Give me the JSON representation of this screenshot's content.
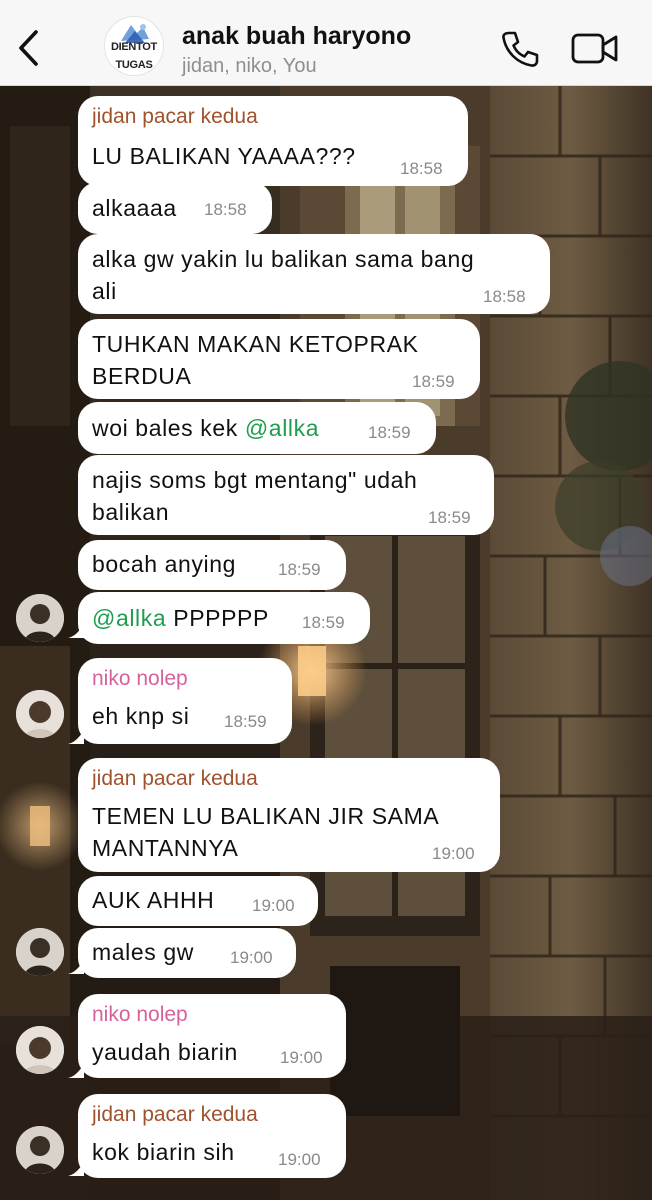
{
  "header": {
    "title": "anak buah haryono",
    "subtitle": "jidan, niko, You",
    "group_logo": {
      "line1": "DIENTOT",
      "line2": "TUGAS"
    },
    "icons": {
      "back": "chevron-left-icon",
      "call": "phone-icon",
      "video": "video-camera-icon"
    }
  },
  "colors": {
    "jidan": "#a0522d",
    "niko": "#d6629a",
    "mention": "#1f9d4f",
    "header_bg": "#f7f7f7"
  },
  "messages": [
    {
      "sender": "jidan pacar kedua",
      "lines": [
        "LU BALIKAN YAAAA???"
      ],
      "time": "18:58"
    },
    {
      "lines": [
        "alkaaaa"
      ],
      "time": "18:58"
    },
    {
      "lines": [
        "alka gw yakin lu balikan sama bang",
        "ali"
      ],
      "time": "18:58"
    },
    {
      "lines": [
        "TUHKAN MAKAN KETOPRAK",
        "BERDUA"
      ],
      "time": "18:59"
    },
    {
      "text_before": "woi bales kek ",
      "mention": "@allka",
      "time": "18:59"
    },
    {
      "lines": [
        "najis soms bgt mentang\" udah",
        "balikan"
      ],
      "time": "18:59"
    },
    {
      "lines": [
        "bocah anying"
      ],
      "time": "18:59"
    },
    {
      "mention": "@allka",
      "text_after": " PPPPPP",
      "time": "18:59"
    },
    {
      "sender": "niko nolep",
      "lines": [
        "eh knp si"
      ],
      "time": "18:59"
    },
    {
      "sender": "jidan pacar kedua",
      "lines": [
        "TEMEN LU BALIKAN JIR SAMA",
        "MANTANNYA"
      ],
      "time": "19:00"
    },
    {
      "lines": [
        "AUK AHHH"
      ],
      "time": "19:00"
    },
    {
      "lines": [
        "males gw"
      ],
      "time": "19:00"
    },
    {
      "sender": "niko nolep",
      "lines": [
        "yaudah biarin"
      ],
      "time": "19:00"
    },
    {
      "sender": "jidan pacar kedua",
      "lines": [
        "kok biarin sih"
      ],
      "time": "19:00"
    }
  ]
}
